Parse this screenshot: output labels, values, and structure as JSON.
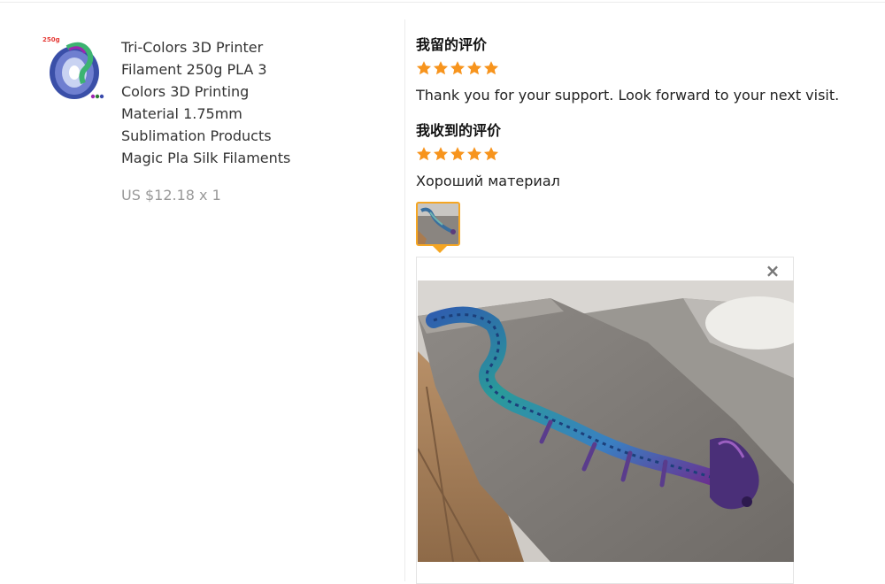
{
  "product": {
    "thumb_badge": "250g",
    "title_lines": [
      "Tri-Colors 3D Printer",
      "Filament 250g PLA 3",
      "Colors 3D Printing",
      "Material 1.75mm",
      "Sublimation Products",
      "Magic Pla Silk Filaments"
    ],
    "price": "US $12.18 x 1"
  },
  "my_review": {
    "heading": "我留的评价",
    "rating": 5,
    "text": "Thank you for your support. Look forward to your next visit."
  },
  "received_review": {
    "heading": "我收到的评价",
    "rating": 5,
    "text": "Хороший материал",
    "attachments": [
      {
        "icon": "photo-thumbnail"
      }
    ]
  },
  "preview": {
    "close_icon": "close-icon",
    "close_glyph": "×"
  },
  "colors": {
    "star": "#f7941d",
    "attachment_border": "#f5a623",
    "price": "#999999"
  }
}
